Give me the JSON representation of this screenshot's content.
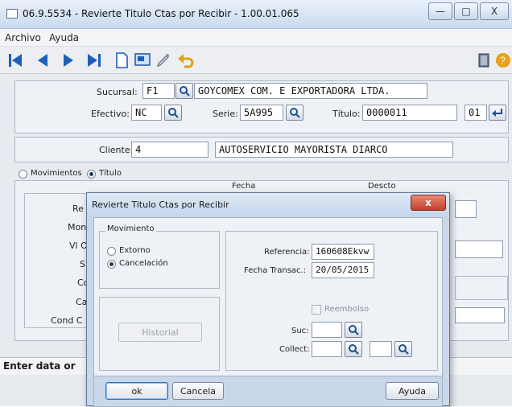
{
  "window": {
    "title": "06.9.5534 - Revierte Titulo Ctas por Recibir - 1.00.01.065",
    "minimize": "—",
    "maximize": "□",
    "close": "X"
  },
  "menu": {
    "items": [
      "Archivo",
      "Ayuda"
    ]
  },
  "form": {
    "sucursal_label": "Sucursal:",
    "sucursal_value": "F1",
    "sucursal_name": "GOYCOMEX COM. E EXPORTADORA LTDA.",
    "efectivo_label": "Efectivo:",
    "efectivo_value": "NC",
    "serie_label": "Serie:",
    "serie_value": "5A995",
    "titulo_label": "Título:",
    "titulo_value": "0000011",
    "titulo_part": "01",
    "cliente_label": "Cliente:",
    "cliente_value": "4",
    "cliente_name": "AUTOSERVICIO MAYORISTA DIARCO",
    "radio_movimientos": "Movimientos",
    "radio_titulo": "Título",
    "col_fecha": "Fecha",
    "col_descto": "Descto",
    "left_labels": [
      "Re",
      "Mon",
      "Vl Ori",
      "S",
      "Co",
      "Ca",
      "Cond C"
    ],
    "status": "Enter data or"
  },
  "dialog": {
    "title": "Revierte Titulo Ctas por Recibir",
    "close": "x",
    "movimiento_legend": "Movimiento",
    "opt_externo": "Extorno",
    "opt_cancelacion": "Cancelación",
    "selected": "Cancelación",
    "referencia_label": "Referencia:",
    "referencia_value": "160608Ekvw",
    "fecha_label": "Fecha Transac.:",
    "fecha_value": "20/05/2015",
    "reembolso_label": "Reembolso",
    "historial_label": "Historial",
    "suc_label": "Suc:",
    "collect_label": "Collect:",
    "ok_label": "ok",
    "cancela_label": "Cancela",
    "ayuda_label": "Ayuda"
  },
  "colors": {
    "accent": "#1f5fb8",
    "close_red": "#c1402c",
    "exit_orange": "#e8a21b"
  }
}
